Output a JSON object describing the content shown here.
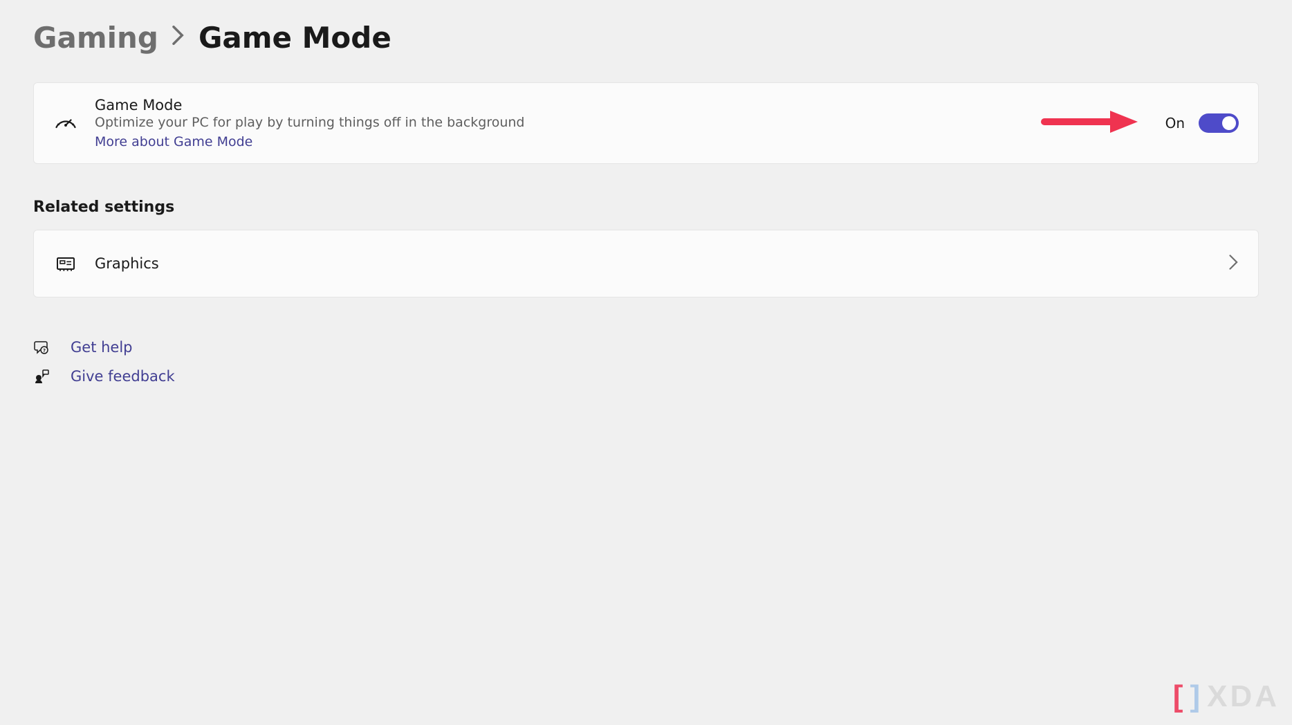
{
  "breadcrumb": {
    "parent": "Gaming",
    "current": "Game Mode"
  },
  "game_mode_card": {
    "title": "Game Mode",
    "description": "Optimize your PC for play by turning things off in the background",
    "link": "More about Game Mode",
    "toggle_state_label": "On"
  },
  "related": {
    "heading": "Related settings",
    "graphics_label": "Graphics"
  },
  "bottom": {
    "get_help": "Get help",
    "give_feedback": "Give feedback"
  },
  "watermark": {
    "text": "XDA"
  }
}
